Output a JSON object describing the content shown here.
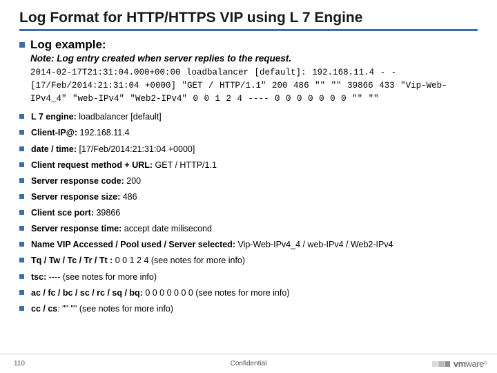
{
  "title": "Log Format for HTTP/HTTPS VIP using L 7 Engine",
  "section_heading": "Log example:",
  "note": "Note: Log entry created when server replies to the request.",
  "log_block": "2014-02-17T21:31:04.000+00:00 loadbalancer [default]: 192.168.11.4 - - [17/Feb/2014:21:31:04 +0000] \"GET / HTTP/1.1\" 200 486 \"\" \"\" 39866 433 \"Vip-Web-IPv4_4\" \"web-IPv4\" \"Web2-IPv4\" 0 0 1 2 4 ---- 0 0 0 0 0 0 0 \"\" \"\"",
  "items": [
    {
      "label": "L 7 engine:",
      "value": " loadbalancer [default]"
    },
    {
      "label": "Client-IP@:",
      "value": " 192.168.11.4"
    },
    {
      "label": "date / time:",
      "value": " [17/Feb/2014:21:31:04 +0000]"
    },
    {
      "label": "Client request method + URL:",
      "value": " GET / HTTP/1.1"
    },
    {
      "label": "Server response code:",
      "value": " 200"
    },
    {
      "label": "Server response size:",
      "value": " 486"
    },
    {
      "label": "Client sce port:",
      "value": " 39866"
    },
    {
      "label": "Server response time:",
      "value": " accept date milisecond"
    },
    {
      "label": "Name VIP Accessed / Pool used / Server selected:",
      "value": " Vip-Web-IPv4_4 / web-IPv4 / Web2-IPv4"
    },
    {
      "label": "Tq / Tw / Tc / Tr / Tt :",
      "value": " 0 0 1 2 4 (see notes for more info)"
    },
    {
      "label": "tsc:",
      "value": " ---- (see notes for more info)"
    },
    {
      "label": "ac / fc / bc / sc / rc / sq / bq:",
      "value": " 0 0 0 0 0 0 0 (see notes for more info)"
    },
    {
      "label": "cc / cs",
      "value": ": \"\" \"\" (see notes for more info)"
    }
  ],
  "footer": {
    "page": "110",
    "confidential": "Confidential",
    "brand1": "vm",
    "brand2": "ware"
  },
  "logo_colors": [
    "#d9d9d9",
    "#b8b8b8",
    "#8e8e8e"
  ]
}
